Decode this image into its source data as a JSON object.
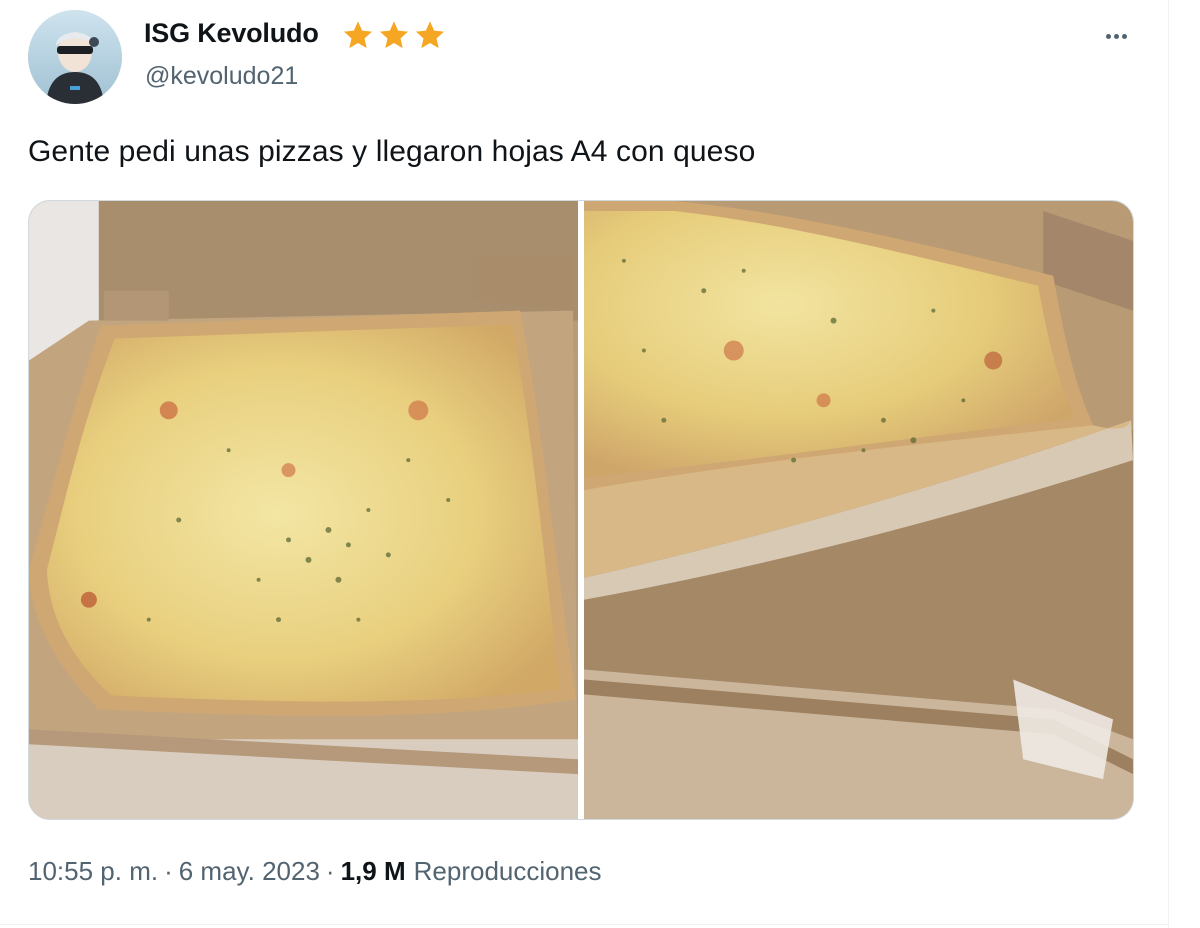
{
  "tweet": {
    "author": {
      "display_name": "ISG Kevoludo",
      "handle": "@kevoludo21",
      "badge_icons": [
        "star-icon",
        "star-icon",
        "star-icon"
      ],
      "badge_color": "#f5a623"
    },
    "more_icon": "more-horizontal-icon",
    "text": "Gente pedi unas pizzas y llegaron hojas A4 con queso",
    "media": [
      {
        "description_icon": "pizza-photo"
      },
      {
        "description_icon": "pizza-photo"
      }
    ],
    "meta": {
      "time": "10:55 p. m.",
      "separator": "·",
      "date": "6 may. 2023",
      "views_count": "1,9 M",
      "views_label": "Reproducciones"
    }
  },
  "colors": {
    "text_primary": "#0f1419",
    "text_secondary": "#536471",
    "border": "#cfd9de"
  }
}
